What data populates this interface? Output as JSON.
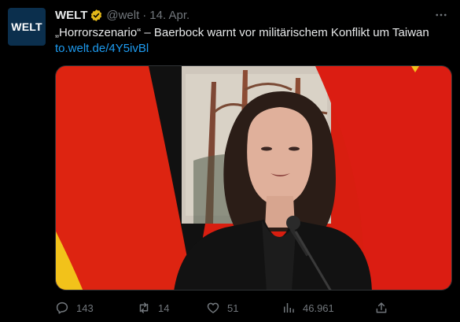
{
  "account": {
    "avatar_text": "WELT",
    "name": "WELT",
    "handle": "@welt",
    "separator": "·",
    "date": "14. Apr."
  },
  "tweet": {
    "text": "„Horrorszenario“ – Baerbock warnt vor militärischem Konflikt um Taiwan",
    "link": "to.welt.de/4Y5ivBl"
  },
  "actions": {
    "replies": "143",
    "reposts": "14",
    "likes": "51",
    "views": "46.961"
  },
  "colors": {
    "background": "#000000",
    "text": "#e7e9ea",
    "muted": "#71767b",
    "link": "#1d9bf0",
    "verified_gold": "#e2b719",
    "avatar_bg": "#0b2f4d"
  },
  "icons": {
    "verified": "verified-badge-icon",
    "more": "more-options-icon",
    "reply": "reply-icon",
    "repost": "repost-icon",
    "like": "heart-icon",
    "views": "views-icon",
    "share": "share-icon"
  }
}
